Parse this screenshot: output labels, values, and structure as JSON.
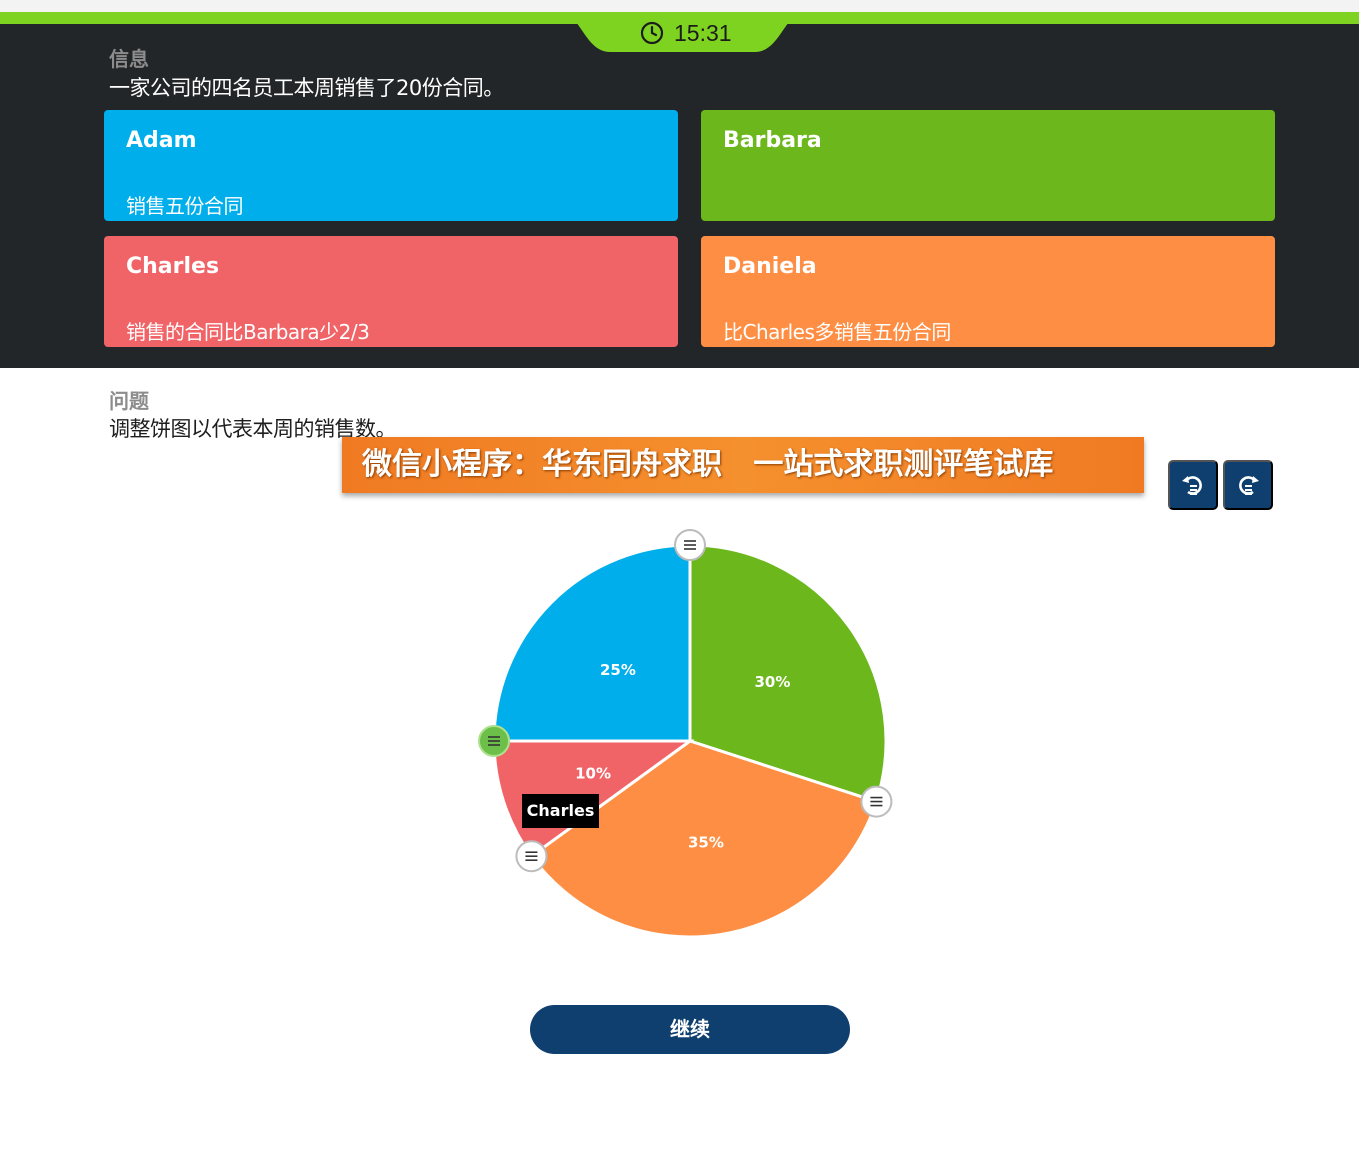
{
  "timer": {
    "time": "15:31",
    "icon": "clock-icon"
  },
  "info": {
    "label": "信息",
    "text": "一家公司的四名员工本周销售了20份合同。"
  },
  "cards": [
    {
      "name": "Adam",
      "desc": "销售五份合同",
      "color": "#00aeeb"
    },
    {
      "name": "Barbara",
      "desc": "",
      "color": "#6bb71c"
    },
    {
      "name": "Charles",
      "desc": "销售的合同比Barbara少2/3",
      "color": "#f06468"
    },
    {
      "name": "Daniela",
      "desc": "比Charles多销售五份合同",
      "color": "#fd8e43"
    }
  ],
  "question": {
    "label": "问题",
    "text": "调整饼图以代表本周的销售数。"
  },
  "banner": {
    "text": "微信小程序：华东同舟求职   一站式求职测评笔试库"
  },
  "controls": {
    "undo_icon": "undo-icon",
    "redo_icon": "redo-icon"
  },
  "chart_data": {
    "type": "pie",
    "slices": [
      {
        "name": "Adam",
        "value": 25,
        "label": "25%",
        "color": "#00aeeb"
      },
      {
        "name": "Barbara",
        "value": 30,
        "label": "30%",
        "color": "#6bb71c"
      },
      {
        "name": "Daniela",
        "value": 35,
        "label": "35%",
        "color": "#fd8e43"
      },
      {
        "name": "Charles",
        "value": 10,
        "label": "10%",
        "color": "#f06468"
      }
    ],
    "active_handle": "Charles"
  },
  "tooltip": {
    "text": "Charles"
  },
  "continue_button": {
    "label": "继续"
  },
  "colors": {
    "dark_bg": "#222629",
    "accent_green": "#7ed321",
    "navy": "#0f3f6e"
  }
}
